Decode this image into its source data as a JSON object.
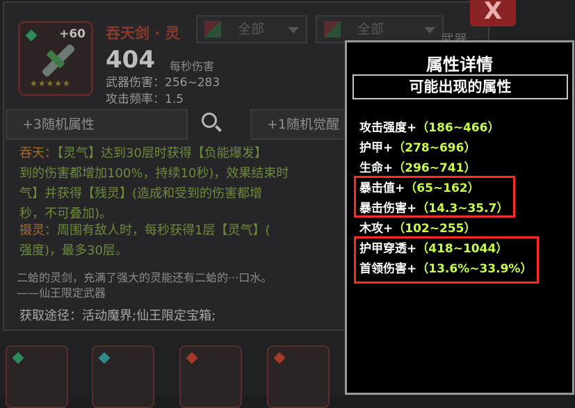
{
  "item": {
    "level": "+60",
    "name": "吞天剑 · 灵",
    "dps": "404",
    "dps_label": "每秒伤害",
    "weapon_damage": "武器伤害：256~283",
    "attack_rate": "攻击频率：1.5",
    "stars": "★★★★★"
  },
  "filters": [
    {
      "label": "全部"
    },
    {
      "label": "全部"
    }
  ],
  "close_label": "X",
  "weapon_tab": "武器",
  "buttons": {
    "random_attr": "+3随机属性",
    "random_awaken": "+1随机觉醒"
  },
  "skills": {
    "line1_kw": "吞天：",
    "line1": "【灵气】达到30层时获得【负能爆发】",
    "line2": "到的伤害都增加100%，持续10秒)，效果结束时",
    "line3": "气】并获得【残灵】(造成和受到的伤害都增",
    "line4": "秒，不可叠加)。",
    "line5_kw": "摄灵：",
    "line5": "周围有敌人时，每秒获得1层【灵气】(",
    "line6": "强度)，最多30层。"
  },
  "lore": {
    "line1": "二蛤的灵剑，充满了强大的灵能还有二蛤的···口水。",
    "line2": "——仙王限定武器"
  },
  "source": "获取途径：活动魔界;仙王限定宝箱;",
  "popup": {
    "title": "属性详情",
    "subtitle": "可能出现的属性",
    "attributes": [
      {
        "name": "攻击强度",
        "range": "（186~466）"
      },
      {
        "name": "护甲",
        "range": "（278~696）"
      },
      {
        "name": "生命",
        "range": "（296~741）"
      },
      {
        "name": "暴击值",
        "range": "（65~162）"
      },
      {
        "name": "暴击伤害",
        "range": "（14.3~35.7）"
      },
      {
        "name": "木攻",
        "range": "（102~255）"
      },
      {
        "name": "护甲穿透",
        "range": "（418~1044）"
      },
      {
        "name": "首领伤害",
        "range": "（13.6%~33.9%）"
      }
    ],
    "plus": "+"
  },
  "colors": {
    "highlight": "#ff2a2a",
    "range_text": "#c7ff46",
    "close_button": "#8a2424"
  }
}
